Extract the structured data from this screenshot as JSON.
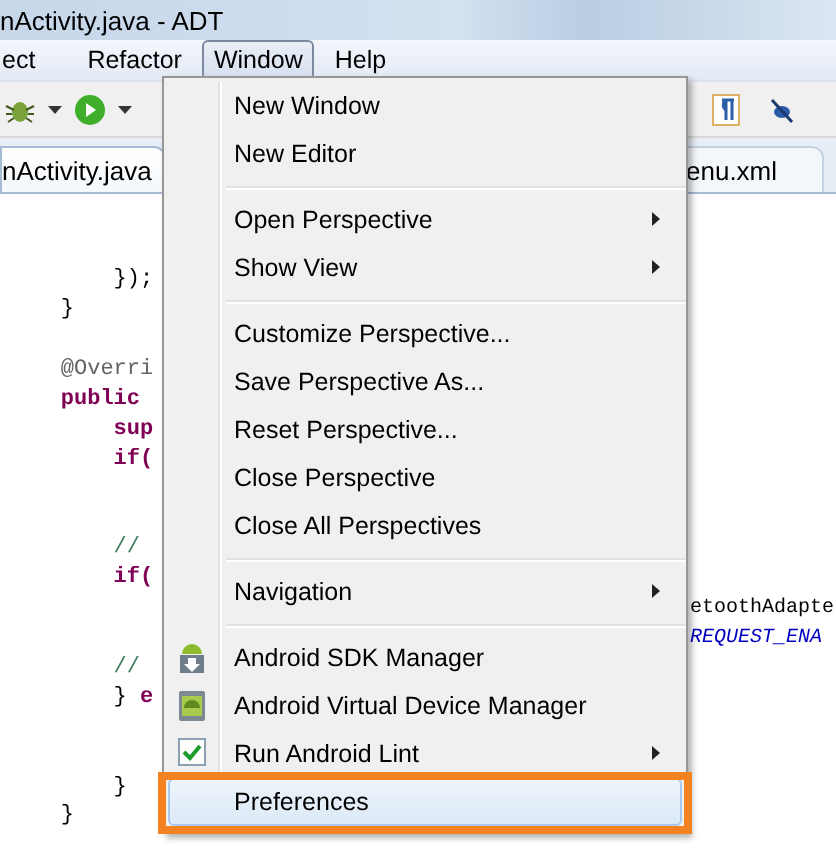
{
  "window": {
    "title": "nActivity.java - ADT"
  },
  "menu_bar": [
    {
      "label": "ect",
      "selected": false
    },
    {
      "label": "Refactor",
      "selected": false
    },
    {
      "label": "Window",
      "selected": true
    },
    {
      "label": "Help",
      "selected": false
    }
  ],
  "editor_tabs": [
    {
      "label": "nActivity.java",
      "selected": true
    },
    {
      "label": "enu.xml",
      "selected": false
    }
  ],
  "code_lines": [
    {
      "kind": "code",
      "parts": [
        {
          "text": "        });",
          "kind": "plain"
        }
      ]
    },
    {
      "kind": "code",
      "parts": [
        {
          "text": "    }",
          "kind": "plain"
        }
      ]
    },
    {
      "kind": "blank"
    },
    {
      "kind": "code",
      "parts": [
        {
          "text": "    @Overri",
          "kind": "annotation"
        }
      ]
    },
    {
      "kind": "code",
      "parts": [
        {
          "text": "    public",
          "kind": "keyword"
        }
      ]
    },
    {
      "kind": "code",
      "parts": [
        {
          "text": "        sup",
          "kind": "keyword"
        }
      ]
    },
    {
      "kind": "code",
      "parts": [
        {
          "text": "        if(",
          "kind": "keyword"
        }
      ]
    },
    {
      "kind": "blank"
    },
    {
      "kind": "blank"
    },
    {
      "kind": "code",
      "parts": [
        {
          "text": "        //",
          "kind": "comment"
        }
      ]
    },
    {
      "kind": "code",
      "parts": [
        {
          "text": "        if(",
          "kind": "keyword"
        }
      ]
    },
    {
      "kind": "overflow",
      "parts": [
        {
          "text": "etoothAdapte",
          "kind": "plain"
        }
      ]
    },
    {
      "kind": "overflow",
      "parts": [
        {
          "text": "REQUEST_ENA",
          "kind": "constant"
        }
      ]
    },
    {
      "kind": "code",
      "parts": [
        {
          "text": "        //",
          "kind": "comment"
        }
      ]
    },
    {
      "kind": "code",
      "parts": [
        {
          "text": "        }",
          "kind": "plain"
        },
        {
          "text": " e",
          "kind": "keyword"
        }
      ]
    },
    {
      "kind": "blank"
    },
    {
      "kind": "blank"
    },
    {
      "kind": "code",
      "parts": [
        {
          "text": "        }",
          "kind": "plain"
        }
      ]
    },
    {
      "kind": "code",
      "parts": [
        {
          "text": "    }",
          "kind": "plain"
        }
      ]
    }
  ],
  "window_menu": [
    {
      "kind": "item",
      "label": "New Window",
      "submenu": false,
      "selected": false
    },
    {
      "kind": "item",
      "label": "New Editor",
      "submenu": false,
      "selected": false
    },
    {
      "kind": "separator"
    },
    {
      "kind": "item",
      "label": "Open Perspective",
      "submenu": true,
      "selected": false
    },
    {
      "kind": "item",
      "label": "Show View",
      "submenu": true,
      "selected": false
    },
    {
      "kind": "separator"
    },
    {
      "kind": "item",
      "label": "Customize Perspective...",
      "submenu": false,
      "selected": false
    },
    {
      "kind": "item",
      "label": "Save Perspective As...",
      "submenu": false,
      "selected": false
    },
    {
      "kind": "item",
      "label": "Reset Perspective...",
      "submenu": false,
      "selected": false
    },
    {
      "kind": "item",
      "label": "Close Perspective",
      "submenu": false,
      "selected": false
    },
    {
      "kind": "item",
      "label": "Close All Perspectives",
      "submenu": false,
      "selected": false
    },
    {
      "kind": "separator"
    },
    {
      "kind": "item",
      "label": "Navigation",
      "submenu": true,
      "selected": false
    },
    {
      "kind": "separator"
    },
    {
      "kind": "download",
      "label": "Android SDK Manager",
      "submenu": false,
      "selected": false
    },
    {
      "kind": "device",
      "label": "Android Virtual Device Manager",
      "submenu": false,
      "selected": false
    },
    {
      "kind": "checkbox",
      "label": "Run Android Lint",
      "submenu": true,
      "selected": false
    },
    {
      "kind": "item",
      "label": "Preferences",
      "submenu": false,
      "selected": true,
      "highlighted": true
    }
  ]
}
